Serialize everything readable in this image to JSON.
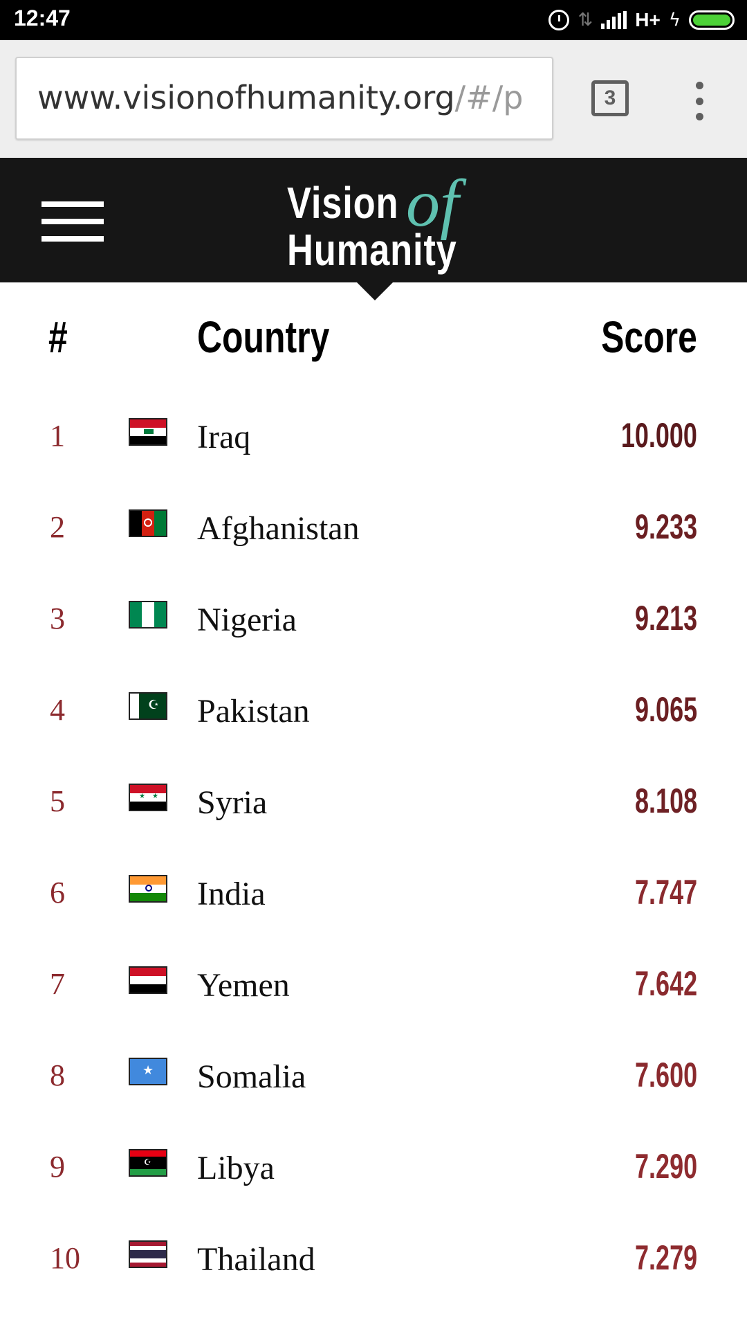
{
  "status_bar": {
    "time": "12:47",
    "network_label": "H+",
    "icons": [
      "alarm-icon",
      "data-arrows-icon",
      "signal-icon",
      "charging-bolt-icon",
      "battery-icon"
    ],
    "battery_color": "#4cd137"
  },
  "browser": {
    "url_main": "www.visionofhumanity.org",
    "url_faded": "/#/p",
    "tab_count": "3",
    "icons": [
      "tabs-icon",
      "overflow-menu-icon"
    ]
  },
  "site_header": {
    "logo_line1": "Vision",
    "logo_of": "of",
    "logo_line2": "Humanity",
    "logo_accent_color": "#5fc1b0",
    "background_color": "#161616"
  },
  "table": {
    "headers": {
      "rank": "#",
      "country": "Country",
      "score": "Score"
    },
    "rows": [
      {
        "rank": "1",
        "country": "Iraq",
        "score": "10.000",
        "score_color": "#5a1a1d",
        "flag": "iraq-flag-icon"
      },
      {
        "rank": "2",
        "country": "Afghanistan",
        "score": "9.233",
        "score_color": "#6b1f22",
        "flag": "afghanistan-flag-icon"
      },
      {
        "rank": "3",
        "country": "Nigeria",
        "score": "9.213",
        "score_color": "#6b1f22",
        "flag": "nigeria-flag-icon"
      },
      {
        "rank": "4",
        "country": "Pakistan",
        "score": "9.065",
        "score_color": "#6b1f22",
        "flag": "pakistan-flag-icon"
      },
      {
        "rank": "5",
        "country": "Syria",
        "score": "8.108",
        "score_color": "#6e2125",
        "flag": "syria-flag-icon"
      },
      {
        "rank": "6",
        "country": "India",
        "score": "7.747",
        "score_color": "#8a2a2e",
        "flag": "india-flag-icon"
      },
      {
        "rank": "7",
        "country": "Yemen",
        "score": "7.642",
        "score_color": "#8a2a2e",
        "flag": "yemen-flag-icon"
      },
      {
        "rank": "8",
        "country": "Somalia",
        "score": "7.600",
        "score_color": "#8a2a2e",
        "flag": "somalia-flag-icon"
      },
      {
        "rank": "9",
        "country": "Libya",
        "score": "7.290",
        "score_color": "#8e2b2f",
        "flag": "libya-flag-icon"
      },
      {
        "rank": "10",
        "country": "Thailand",
        "score": "7.279",
        "score_color": "#8e2b2f",
        "flag": "thailand-flag-icon"
      }
    ]
  }
}
